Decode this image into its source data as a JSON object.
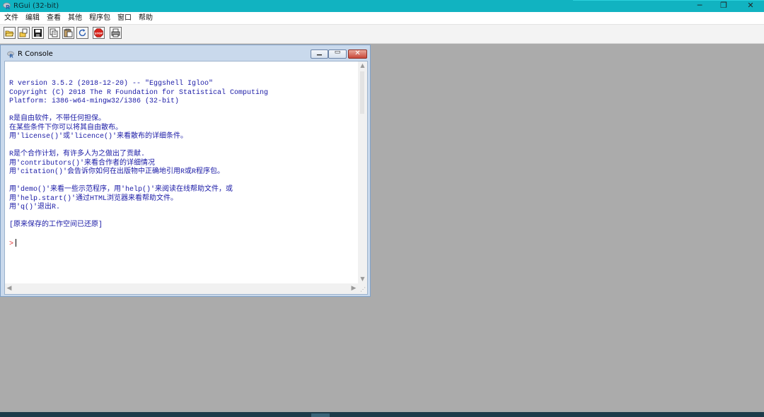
{
  "window": {
    "title": "RGui (32-bit)",
    "minimize": "─",
    "restore": "❐",
    "close": "✕"
  },
  "menu": {
    "items": [
      "文件",
      "编辑",
      "查看",
      "其他",
      "程序包",
      "窗口",
      "帮助"
    ]
  },
  "toolbar": {
    "buttons": [
      {
        "icon": "open-script-icon"
      },
      {
        "icon": "load-workspace-icon"
      },
      {
        "icon": "save-icon"
      },
      {
        "icon": "copy-icon"
      },
      {
        "icon": "paste-icon"
      },
      {
        "icon": "refresh-icon"
      },
      {
        "icon": "stop-icon",
        "label": "STOP"
      },
      {
        "icon": "print-icon"
      }
    ]
  },
  "console": {
    "title": "R Console",
    "lines": [
      "R version 3.5.2 (2018-12-20) -- \"Eggshell Igloo\"",
      "Copyright (C) 2018 The R Foundation for Statistical Computing",
      "Platform: i386-w64-mingw32/i386 (32-bit)",
      "",
      "R是自由软件，不带任何担保。",
      "在某些条件下你可以将其自由散布。",
      "用'license()'或'licence()'来看散布的详细条件。",
      "",
      "R是个合作计划，有许多人为之做出了贡献.",
      "用'contributors()'来看合作者的详细情况",
      "用'citation()'会告诉你如何在出版物中正确地引用R或R程序包。",
      "",
      "用'demo()'来看一些示范程序，用'help()'来阅读在线帮助文件，或",
      "用'help.start()'通过HTML浏览器来看帮助文件。",
      "用'q()'退出R.",
      "",
      "[原来保存的工作空间已还原]",
      ""
    ],
    "prompt": ">"
  },
  "colors": {
    "titlebar": "#11b3c1",
    "console_text": "#1a1aa6",
    "prompt": "#e03030",
    "mdi_background": "#ababab"
  }
}
